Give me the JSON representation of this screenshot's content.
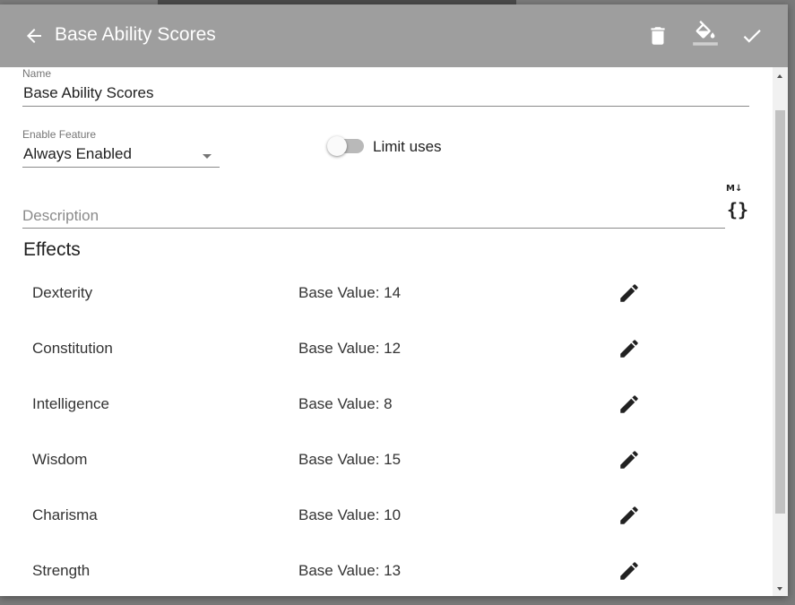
{
  "toolbar": {
    "title": "Base Ability Scores",
    "back_icon": "arrow-left-icon",
    "actions": [
      {
        "name": "delete",
        "icon": "trash-icon"
      },
      {
        "name": "color",
        "icon": "paint-bucket-icon"
      },
      {
        "name": "confirm",
        "icon": "checkmark-icon"
      }
    ]
  },
  "form": {
    "name_label": "Name",
    "name_value": "Base Ability Scores",
    "enable_label": "Enable Feature",
    "enable_value": "Always Enabled",
    "limit_uses_label": "Limit uses",
    "limit_uses_on": false,
    "description_placeholder": "Description",
    "markdown_icon_text": "M↓",
    "braces_icon_text": "{}"
  },
  "effects": {
    "title": "Effects",
    "items": [
      {
        "name": "Dexterity",
        "value": "Base Value: 14"
      },
      {
        "name": "Constitution",
        "value": "Base Value: 12"
      },
      {
        "name": "Intelligence",
        "value": "Base Value: 8"
      },
      {
        "name": "Wisdom",
        "value": "Base Value: 15"
      },
      {
        "name": "Charisma",
        "value": "Base Value: 10"
      },
      {
        "name": "Strength",
        "value": "Base Value: 13"
      }
    ]
  },
  "colors": {
    "toolbar": "#9e9e9e",
    "backdrop": "#7a7a7a",
    "text": "#212121"
  }
}
